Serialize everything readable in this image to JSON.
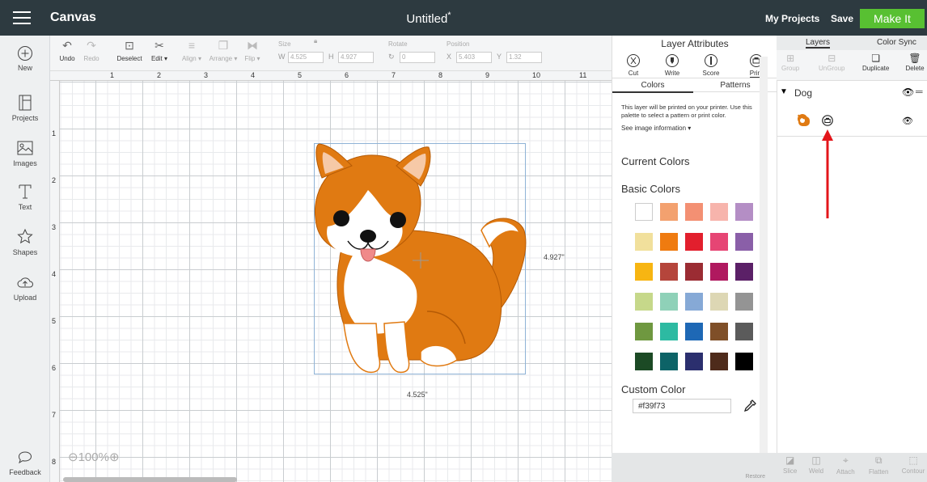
{
  "topbar": {
    "app_title": "Canvas",
    "doc_title": "Untitled",
    "doc_modified_mark": "*",
    "my_projects": "My Projects",
    "save": "Save",
    "make_it": "Make It"
  },
  "leftbar": [
    {
      "label": "New",
      "icon": "plus-circle-icon"
    },
    {
      "label": "Projects",
      "icon": "projects-icon"
    },
    {
      "label": "Images",
      "icon": "image-icon"
    },
    {
      "label": "Text",
      "icon": "text-icon"
    },
    {
      "label": "Shapes",
      "icon": "shapes-icon"
    },
    {
      "label": "Upload",
      "icon": "upload-icon"
    },
    {
      "label": "Feedback",
      "icon": "chat-bubble-icon"
    }
  ],
  "toolbar": {
    "undo": "Undo",
    "redo": "Redo",
    "deselect": "Deselect",
    "edit": "Edit",
    "align": "Align",
    "arrange": "Arrange",
    "flip": "Flip",
    "size_label": "Size",
    "w_label": "W",
    "w_value": "4.525",
    "h_label": "H",
    "h_value": "4.927",
    "rotate_label": "Rotate",
    "rotate_value": "0",
    "position_label": "Position",
    "x_label": "X",
    "x_value": "5.403",
    "y_label": "Y",
    "y_value": "1.32"
  },
  "rulers": {
    "top": [
      "1",
      "2",
      "3",
      "4",
      "5",
      "6",
      "7",
      "8",
      "9",
      "10",
      "11"
    ],
    "left": [
      "1",
      "2",
      "3",
      "4",
      "5",
      "6",
      "7",
      "8"
    ]
  },
  "canvas": {
    "height_dim": "4.927\"",
    "width_dim": "4.525\"",
    "zoom": "100%",
    "image_name": "Dog"
  },
  "attributes": {
    "title": "Layer Attributes",
    "buttons": [
      "Cut",
      "Write",
      "Score",
      "Print"
    ],
    "tabs": [
      "Colors",
      "Patterns"
    ],
    "description": "This layer will be printed on your printer. Use this palette to select a pattern or print color.",
    "see_info": "See image information",
    "current_colors": "Current Colors",
    "basic_colors": "Basic Colors",
    "custom_color": "Custom Color",
    "custom_hex": "#f39f73",
    "restore": "Restore",
    "swatches": [
      "#ffffff",
      "#f3a16f",
      "#f39073",
      "#f7b4ac",
      "#b48ec5",
      "#f1e09c",
      "#ef7b10",
      "#e21f2d",
      "#e64574",
      "#8a5fa8",
      "#f7b512",
      "#b5453b",
      "#9b2c33",
      "#b0195f",
      "#5b2067",
      "#c6d88a",
      "#8fd1b8",
      "#86a9d6",
      "#ddd7b4",
      "#949494",
      "#6f9840",
      "#2dbaa2",
      "#1e68b5",
      "#7f4f28",
      "#5b5b5b",
      "#1c4a25",
      "#0d6367",
      "#2b2f6e",
      "#4e2b1b",
      "#000000"
    ]
  },
  "layers": {
    "tabs": [
      "Layers",
      "Color Sync"
    ],
    "tools": [
      "Group",
      "UnGroup",
      "Duplicate",
      "Delete"
    ],
    "group_name": "Dog",
    "bottom_tools": [
      "Slice",
      "Weld",
      "Attach",
      "Flatten",
      "Contour"
    ]
  },
  "colors": {
    "topbar": "#2d3a40",
    "make_it": "#58c032",
    "annotation_arrow": "#e3151a",
    "dog_orange": "#e07a12"
  }
}
